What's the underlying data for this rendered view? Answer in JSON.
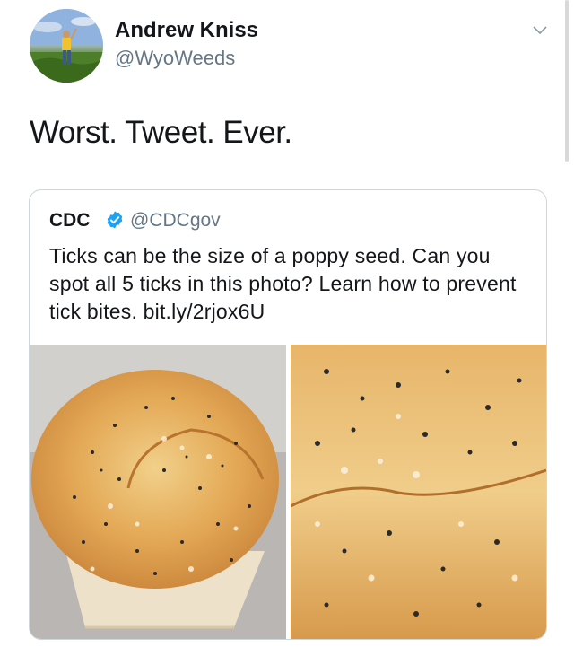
{
  "author": {
    "name": "Andrew Kniss",
    "handle": "@WyoWeeds"
  },
  "tweet": {
    "text": "Worst. Tweet. Ever."
  },
  "quoted_tweet": {
    "name": "CDC",
    "handle": "@CDCgov",
    "text": "Ticks can be the size of a poppy seed. Can you spot all 5 ticks in this photo? Learn how to prevent tick bites. bit.ly/2rjox6U",
    "verified": true
  },
  "icons": {
    "menu": "chevron-down-icon",
    "verified": "verified-badge-icon"
  },
  "colors": {
    "secondary_text": "#657786",
    "verified_blue": "#1da1f2",
    "card_border": "#ccd6dd"
  }
}
